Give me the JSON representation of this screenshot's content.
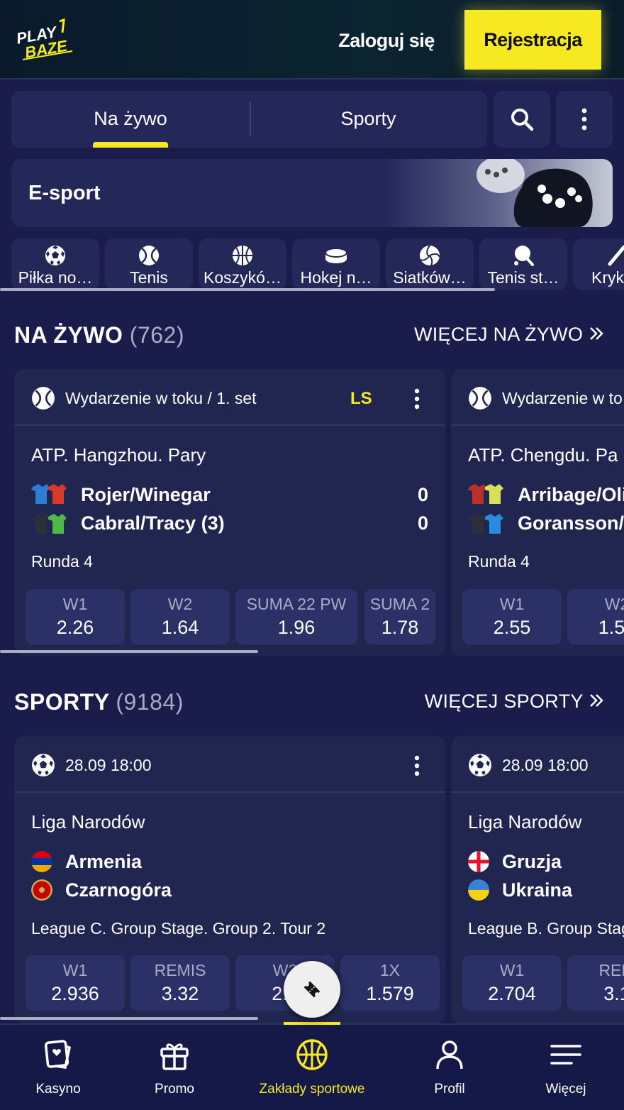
{
  "header": {
    "logo_text_top": "PLAY",
    "logo_text_bottom": "BAZE",
    "login_label": "Zaloguj się",
    "register_label": "Rejestracja"
  },
  "tabs": [
    {
      "label": "Na żywo",
      "active": true
    },
    {
      "label": "Sporty",
      "active": false
    }
  ],
  "toolbar": {
    "search_icon": "search-icon",
    "menu_icon": "more-vertical-icon"
  },
  "esport_banner": {
    "title": "E-sport",
    "image": "gamepad"
  },
  "categories": [
    {
      "label": "Piłka no…",
      "icon": "soccer-ball-icon"
    },
    {
      "label": "Tenis",
      "icon": "tennis-ball-icon"
    },
    {
      "label": "Koszykó…",
      "icon": "basketball-icon"
    },
    {
      "label": "Hokej n…",
      "icon": "hockey-puck-icon"
    },
    {
      "label": "Siatków…",
      "icon": "volleyball-icon"
    },
    {
      "label": "Tenis st…",
      "icon": "table-tennis-icon"
    },
    {
      "label": "Kryk",
      "icon": "cricket-bat-icon"
    }
  ],
  "live_section": {
    "title": "NA ŻYWO",
    "count": "(762)",
    "more_label": "WIĘCEJ NA ŻYWO",
    "cards": [
      {
        "status": "Wydarzenie w toku / 1. set",
        "badge": "LS",
        "league": "ATP. Hangzhou. Pary",
        "team1": "Rojer/Winegar",
        "team2": "Cabral/Tracy (3)",
        "score1": "0",
        "score2": "0",
        "round": "Runda 4",
        "odds": [
          {
            "name": "W1",
            "value": "2.26"
          },
          {
            "name": "W2",
            "value": "1.64"
          },
          {
            "name": "SUMA 22 PW",
            "value": "1.96"
          },
          {
            "name": "SUMA 2",
            "value": "1.78"
          }
        ]
      },
      {
        "status": "Wydarzenie w to",
        "league": "ATP. Chengdu. Pa",
        "team1": "Arribage/Oli",
        "team2": "Goransson/",
        "round": "Runda 4",
        "odds": [
          {
            "name": "W1",
            "value": "2.55"
          },
          {
            "name": "W2",
            "value": "1.51"
          }
        ]
      }
    ]
  },
  "sports_section": {
    "title": "SPORTY",
    "count": "(9184)",
    "more_label": "WIĘCEJ SPORTY",
    "cards": [
      {
        "date": "28.09 18:00",
        "league": "Liga Narodów",
        "team1": "Armenia",
        "team2": "Czarnogóra",
        "stage": "League C. Group Stage. Group 2. Tour 2",
        "odds": [
          {
            "name": "W1",
            "value": "2.936"
          },
          {
            "name": "REMIS",
            "value": "3.32"
          },
          {
            "name": "W2",
            "value": "2.4"
          },
          {
            "name": "1X",
            "value": "1.579"
          }
        ]
      },
      {
        "date": "28.09 18:00",
        "league": "Liga Narodów",
        "team1": "Gruzja",
        "team2": "Ukraina",
        "stage": "League B. Group Stag",
        "odds": [
          {
            "name": "W1",
            "value": "2.704"
          },
          {
            "name": "REM",
            "value": "3.1"
          }
        ]
      }
    ]
  },
  "bottom_nav": [
    {
      "label": "Kasyno",
      "icon": "casino-card-icon",
      "active": false
    },
    {
      "label": "Promo",
      "icon": "gift-icon",
      "active": false
    },
    {
      "label": "Zakłady sportowe",
      "icon": "basketball-icon",
      "active": true
    },
    {
      "label": "Profil",
      "icon": "user-icon",
      "active": false
    },
    {
      "label": "Więcej",
      "icon": "menu-lines-icon",
      "active": false
    }
  ],
  "colors": {
    "accent": "#f6e921",
    "background": "#1a1d4b",
    "card": "#20264f",
    "odd_button": "#2b3166"
  }
}
